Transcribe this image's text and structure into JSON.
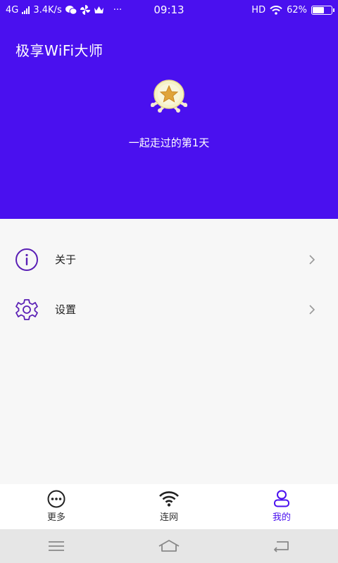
{
  "status_bar": {
    "network": "4G",
    "speed": "3.4K/s",
    "more": "···",
    "time": "09:13",
    "hd": "HD",
    "battery": "62%",
    "battery_level": 0.62
  },
  "header": {
    "app_title": "极享WiFi大师",
    "days_text": "一起走过的第1天"
  },
  "menu": {
    "items": [
      {
        "label": "关于",
        "icon": "info-icon"
      },
      {
        "label": "设置",
        "icon": "gear-icon"
      }
    ]
  },
  "tabs": [
    {
      "label": "更多",
      "icon": "more-icon",
      "active": false
    },
    {
      "label": "连网",
      "icon": "wifi-icon",
      "active": false
    },
    {
      "label": "我的",
      "icon": "profile-icon",
      "active": true
    }
  ],
  "colors": {
    "accent": "#4a10ef",
    "background": "#f7f7f7",
    "tabbar": "#ffffff",
    "navbar": "#e6e6e6"
  }
}
